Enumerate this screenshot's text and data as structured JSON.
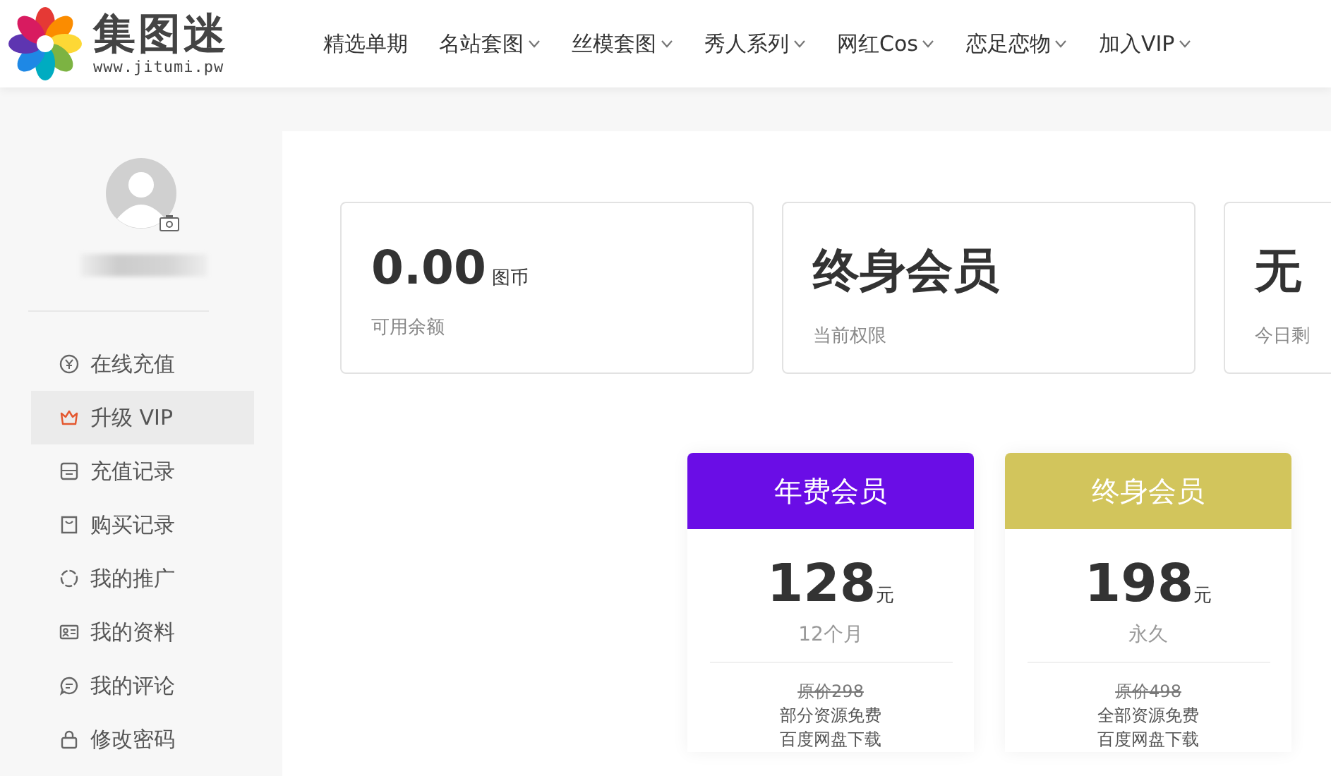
{
  "logo": {
    "title": "集图迷",
    "url": "www.jitumi.pw"
  },
  "nav": [
    {
      "label": "精选单期",
      "has_dropdown": false
    },
    {
      "label": "名站套图",
      "has_dropdown": true
    },
    {
      "label": "丝模套图",
      "has_dropdown": true
    },
    {
      "label": "秀人系列",
      "has_dropdown": true
    },
    {
      "label": "网红Cos",
      "has_dropdown": true
    },
    {
      "label": "恋足恋物",
      "has_dropdown": true
    },
    {
      "label": "加入VIP",
      "has_dropdown": true
    }
  ],
  "sidebar": {
    "items": [
      {
        "label": "在线充值",
        "selected": false
      },
      {
        "label": "升级 VIP",
        "selected": true
      },
      {
        "label": "充值记录",
        "selected": false
      },
      {
        "label": "购买记录",
        "selected": false
      },
      {
        "label": "我的推广",
        "selected": false
      },
      {
        "label": "我的资料",
        "selected": false
      },
      {
        "label": "我的评论",
        "selected": false
      },
      {
        "label": "修改密码",
        "selected": false
      }
    ]
  },
  "stats": [
    {
      "value": "0.00",
      "unit": "图币",
      "label": "可用余额"
    },
    {
      "value": "终身会员",
      "label": "当前权限"
    },
    {
      "value": "无",
      "label": "今日剩"
    }
  ],
  "plans": [
    {
      "title": "年费会员",
      "color": "#6a0de6",
      "price": "128",
      "currency": "元",
      "period": "12个月",
      "features": [
        {
          "kind": "original_price",
          "text": "原价298"
        },
        {
          "kind": "feature",
          "text": "部分资源免费"
        },
        {
          "kind": "feature",
          "text": "百度网盘下载"
        }
      ]
    },
    {
      "title": "终身会员",
      "color": "#d2c55c",
      "price": "198",
      "currency": "元",
      "period": "永久",
      "features": [
        {
          "kind": "original_price",
          "text": "原价498"
        },
        {
          "kind": "feature",
          "text": "全部资源免费"
        },
        {
          "kind": "feature",
          "text": "百度网盘下载"
        }
      ]
    }
  ]
}
